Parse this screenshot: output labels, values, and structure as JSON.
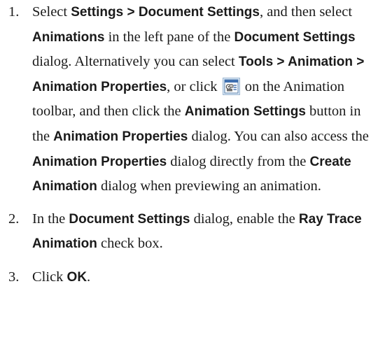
{
  "steps": [
    {
      "number": "1.",
      "parts": {
        "t1": "Select ",
        "b1": "Settings > Document Settings",
        "t2": ", and then select ",
        "b2": "Animations",
        "t3": " in the left pane of the ",
        "b3": "Document Settings",
        "t4": " dialog. Alternatively you can select ",
        "b4": "Tools > Animation > Animation Properties",
        "t5": ", or click ",
        "t6": " on the Animation toolbar, and then click the ",
        "b5": "Animation Set­tings",
        "t7": " button in the ",
        "b6": "Animation Properties",
        "t8": " dia­log. You can also access the ",
        "b7": "Animation Properties",
        "t9": " dialog directly from the ",
        "b8": "Create Animation",
        "t10": " dialog when previewing an anim­ation."
      }
    },
    {
      "number": "2.",
      "parts": {
        "t1": "In the ",
        "b1": "Document Settings",
        "t2": " dialog, enable the ",
        "b2": "Ray Trace Animation",
        "t3": " check box."
      }
    },
    {
      "number": "3.",
      "parts": {
        "t1": "Click ",
        "b1": "OK",
        "t2": "."
      }
    }
  ],
  "icons": {
    "animation_properties": "animation-properties-icon"
  }
}
